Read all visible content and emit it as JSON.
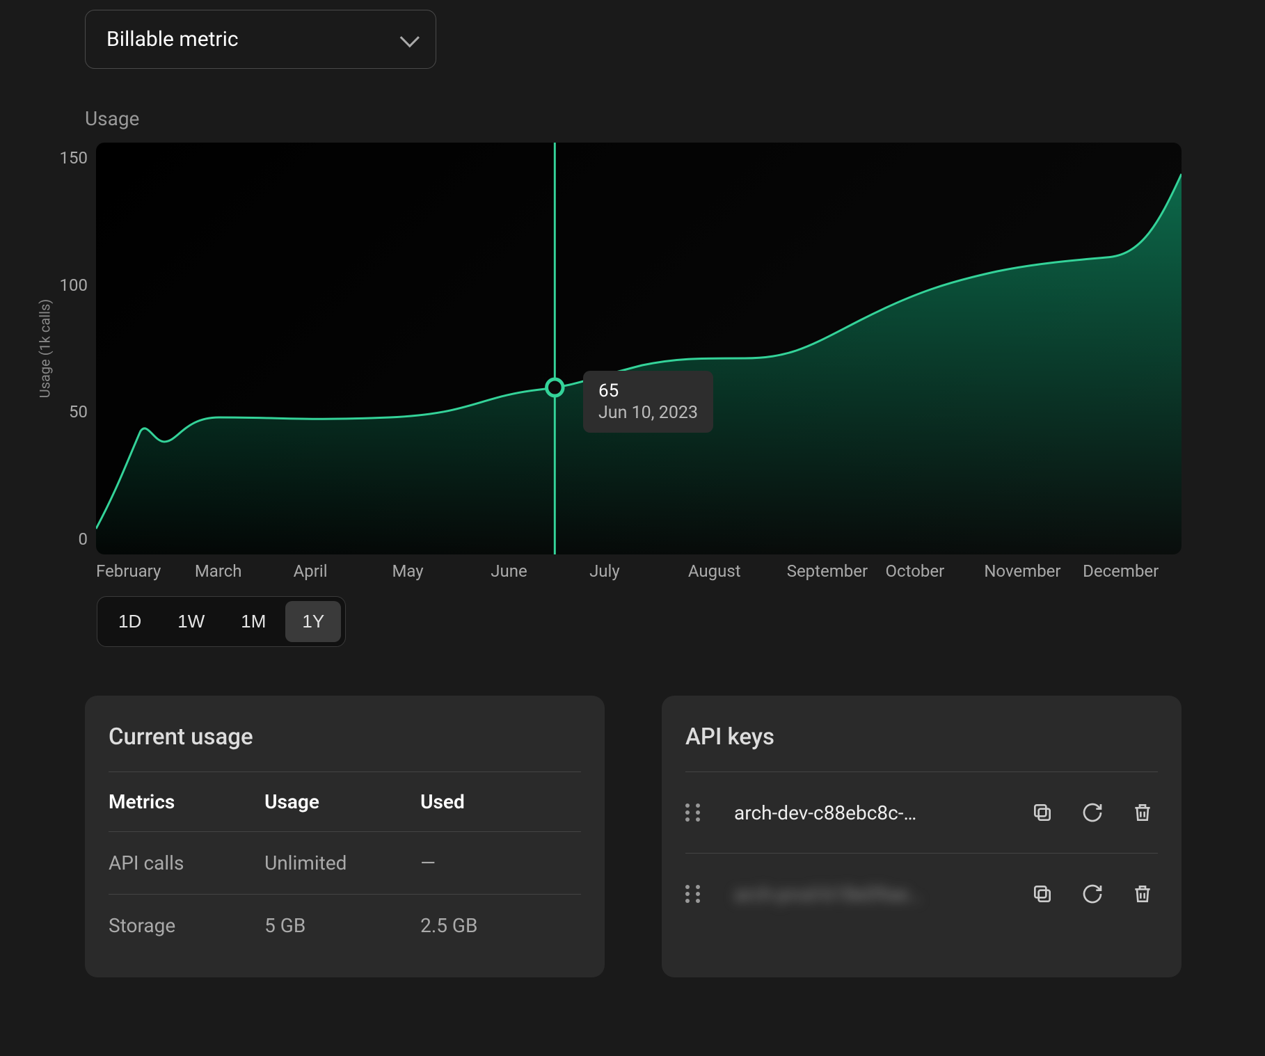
{
  "dropdown": {
    "label": "Billable metric"
  },
  "chart": {
    "title": "Usage",
    "y_axis_label": "Usage (1k calls)",
    "y_ticks": [
      "150",
      "100",
      "50",
      "0"
    ],
    "x_ticks": [
      "February",
      "March",
      "April",
      "May",
      "June",
      "July",
      "August",
      "September",
      "October",
      "November",
      "December"
    ],
    "tooltip": {
      "value": "65",
      "date": "Jun 10, 2023"
    },
    "ranges": [
      "1D",
      "1W",
      "1M",
      "1Y"
    ],
    "active_range": "1Y"
  },
  "usage_card": {
    "title": "Current usage",
    "headers": [
      "Metrics",
      "Usage",
      "Used"
    ],
    "rows": [
      {
        "metric": "API calls",
        "usage": "Unlimited",
        "used": "—"
      },
      {
        "metric": "Storage",
        "usage": "5 GB",
        "used": "2.5 GB"
      }
    ]
  },
  "api_card": {
    "title": "API keys",
    "keys": [
      {
        "name": "arch-dev-c88ebc8c-…",
        "blurred": false
      },
      {
        "name": "arch-prod-b18e09ae…",
        "blurred": true
      }
    ]
  },
  "chart_data": {
    "type": "area",
    "title": "Usage",
    "xlabel": "",
    "ylabel": "Usage (1k calls)",
    "ylim": [
      0,
      150
    ],
    "x": [
      "Feb",
      "Mar",
      "Apr",
      "May",
      "Jun",
      "Jun 10",
      "Jul",
      "Aug",
      "Sep",
      "Oct",
      "Nov",
      "Dec"
    ],
    "values": [
      10,
      40,
      42,
      48,
      55,
      65,
      68,
      75,
      92,
      100,
      105,
      140
    ],
    "highlight": {
      "x": "Jun 10, 2023",
      "y": 65
    }
  }
}
